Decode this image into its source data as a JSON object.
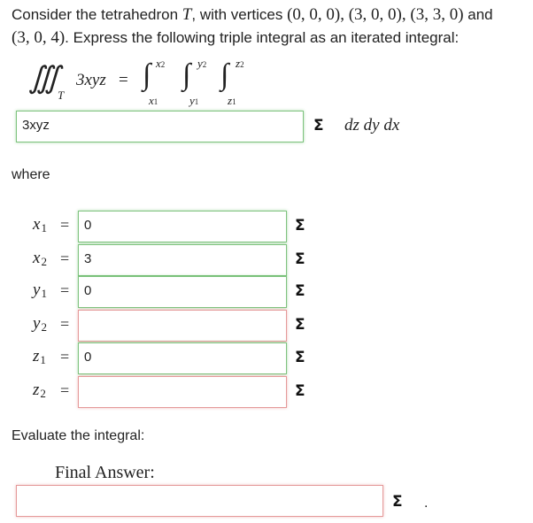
{
  "question": {
    "text_1": "Consider the tetrahedron ",
    "T": "T",
    "text_2": ", with vertices ",
    "vertices_line1": "(0, 0, 0), (3, 0, 0), (3, 3, 0)",
    "and": " and",
    "vertices_line2": "(3, 0, 4)",
    "text_3": ". Express the following triple integral as an iterated integral:"
  },
  "integral": {
    "integrand": "3xyz",
    "region": "T",
    "lower_x": "x",
    "lower_x_sub": "1",
    "upper_x": "x",
    "upper_x_sub": "2",
    "lower_y": "y",
    "lower_y_sub": "1",
    "upper_y": "y",
    "upper_y_sub": "2",
    "lower_z": "z",
    "lower_z_sub": "1",
    "upper_z": "z",
    "upper_z_sub": "2",
    "differentials": "dz dy dx"
  },
  "integrand_field": {
    "value": "3xyz"
  },
  "where_label": "where",
  "bounds": [
    {
      "var": "x",
      "sub": "1",
      "value": "0",
      "status": "ok"
    },
    {
      "var": "x",
      "sub": "2",
      "value": "3",
      "status": "ok"
    },
    {
      "var": "y",
      "sub": "1",
      "value": "0",
      "status": "ok"
    },
    {
      "var": "y",
      "sub": "2",
      "value": "",
      "status": "bad"
    },
    {
      "var": "z",
      "sub": "1",
      "value": "0",
      "status": "ok"
    },
    {
      "var": "z",
      "sub": "2",
      "value": "",
      "status": "bad"
    }
  ],
  "evaluate_label": "Evaluate the integral:",
  "final_answer_label": "Final Answer:",
  "final_answer_field": {
    "value": ""
  },
  "icons": {
    "sigma": "Σ"
  },
  "colors": {
    "correct_border": "#7fc37f",
    "incorrect_border": "#e59a9a"
  }
}
